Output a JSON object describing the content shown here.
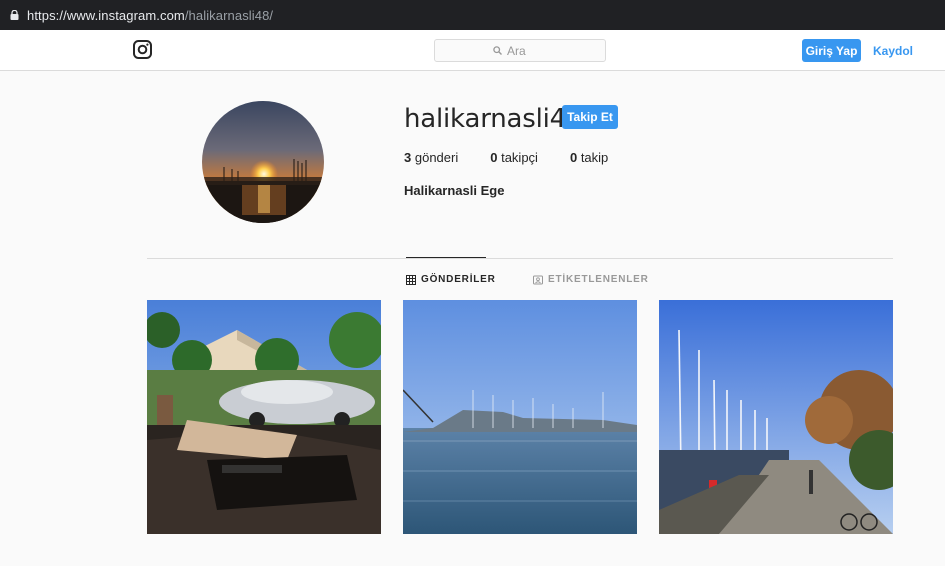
{
  "browser": {
    "url_host": "https://www.instagram.com",
    "url_path": "/halikarnasli48/"
  },
  "header": {
    "logo_icon": "instagram-camera-icon",
    "search_placeholder": "Ara",
    "login_label": "Giriş Yap",
    "signup_label": "Kaydol"
  },
  "profile": {
    "username": "halikarnasli48",
    "follow_label": "Takip Et",
    "posts_count": "3",
    "posts_label": "gönderi",
    "followers_count": "0",
    "followers_label": "takipçi",
    "following_count": "0",
    "following_label": "takip",
    "full_name": "Halikarnasli Ege"
  },
  "tabs": [
    {
      "label": "GÖNDERİLER",
      "icon": "grid-icon",
      "active": true
    },
    {
      "label": "ETİKETLENENLER",
      "icon": "tagged-icon",
      "active": false
    }
  ],
  "colors": {
    "accent": "#3897f0",
    "border": "#dbdbdb",
    "background": "#fafafa"
  }
}
